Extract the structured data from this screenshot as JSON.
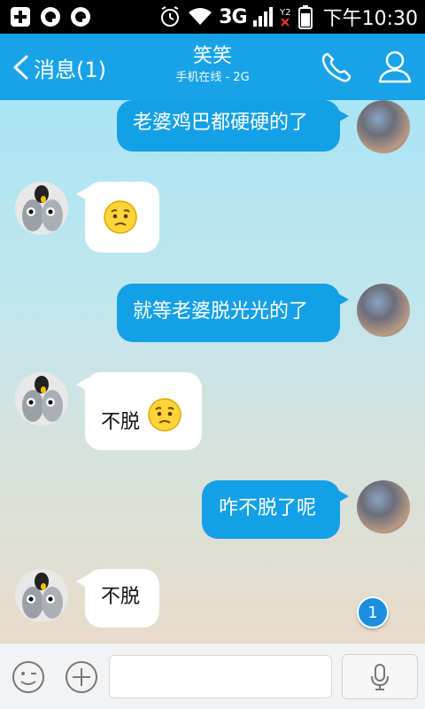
{
  "status_bar": {
    "network": "3G",
    "time": "下午10:30",
    "icons": [
      "add-icon",
      "qq-icon",
      "qq-icon",
      "alarm-icon",
      "wifi-icon",
      "signal-icon",
      "sim-icon",
      "battery-icon"
    ]
  },
  "header": {
    "back_label": "消息(1)",
    "title": "笑笑",
    "subtitle": "手机在线 - 2G",
    "background": "#18a3e8"
  },
  "messages": [
    {
      "side": "out",
      "text": "老婆鸡巴都硬硬的了"
    },
    {
      "side": "in",
      "emoji": "confused-face-emoji"
    },
    {
      "side": "out",
      "text": "就等老婆脱光光的了"
    },
    {
      "side": "in",
      "text": "不脱",
      "emoji": "confused-face-emoji"
    },
    {
      "side": "out",
      "text": "咋不脱了呢"
    },
    {
      "side": "in",
      "text": "不脱"
    }
  ],
  "unread_badge": "1",
  "colors": {
    "bubble_out": "#14a0e6",
    "bubble_in": "#ffffff",
    "accent": "#18a3e8"
  }
}
